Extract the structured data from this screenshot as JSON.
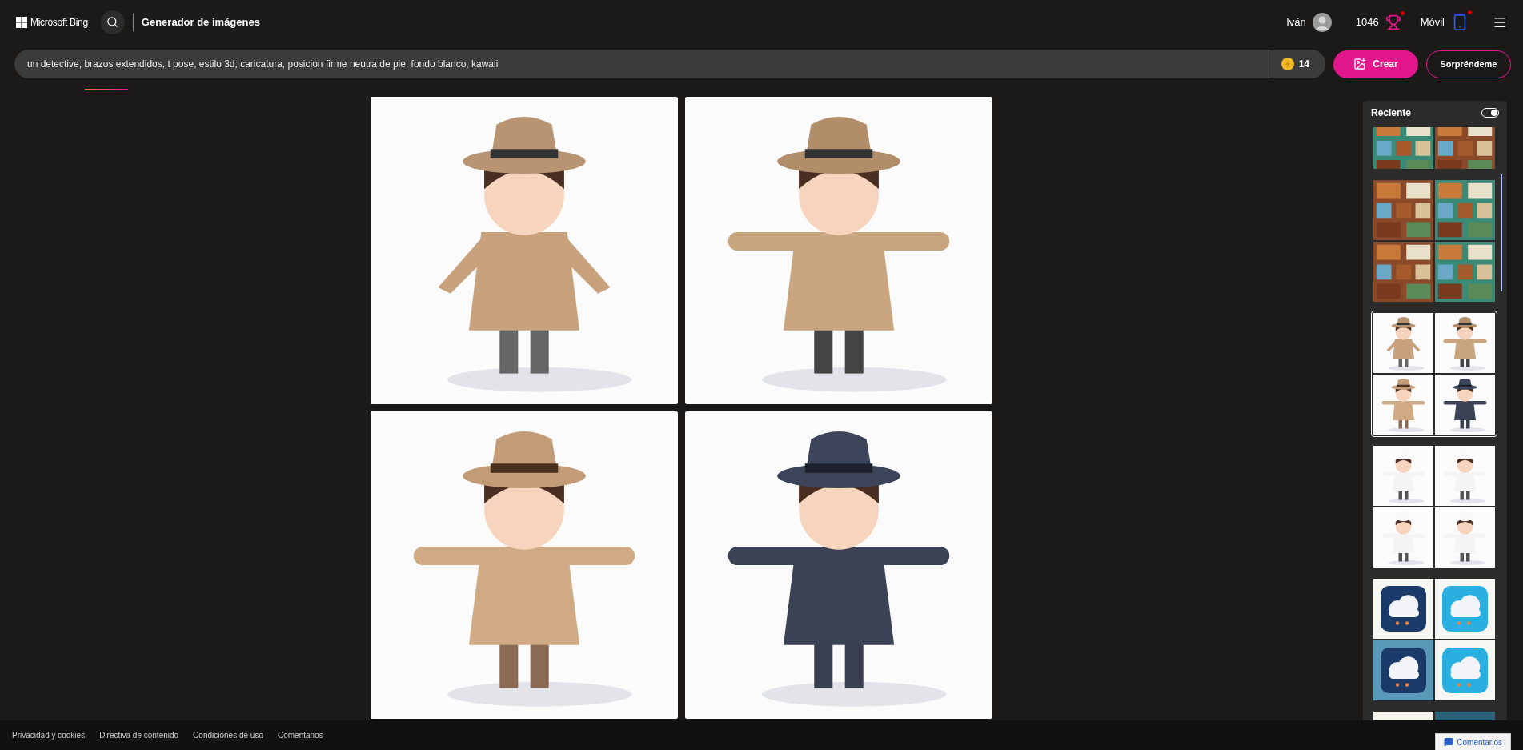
{
  "header": {
    "brand": "Microsoft Bing",
    "title": "Generador de imágenes",
    "user": {
      "name": "Iván"
    },
    "rewards": {
      "points": "1046",
      "notification": true
    },
    "mobile": {
      "label": "Móvil",
      "notification": true
    }
  },
  "prompt": {
    "value": "un detective, brazos extendidos, t pose, estilo 3d, caricatura, posicion firme neutra de pie, fondo blanco, kawaii",
    "coins": "14"
  },
  "buttons": {
    "create": "Crear",
    "surprise": "Sorpréndeme"
  },
  "sidebar": {
    "title": "Reciente",
    "toggle": {
      "on": true
    },
    "groups": [
      {
        "selected": false
      },
      {
        "selected": false
      },
      {
        "selected": true
      },
      {
        "selected": false
      },
      {
        "selected": false
      },
      {
        "selected": false
      }
    ]
  },
  "footer": {
    "links": [
      "Privacidad y cookies",
      "Directiva de contenido",
      "Condiciones de uso",
      "Comentarios"
    ],
    "feedback": "Comentarios"
  }
}
